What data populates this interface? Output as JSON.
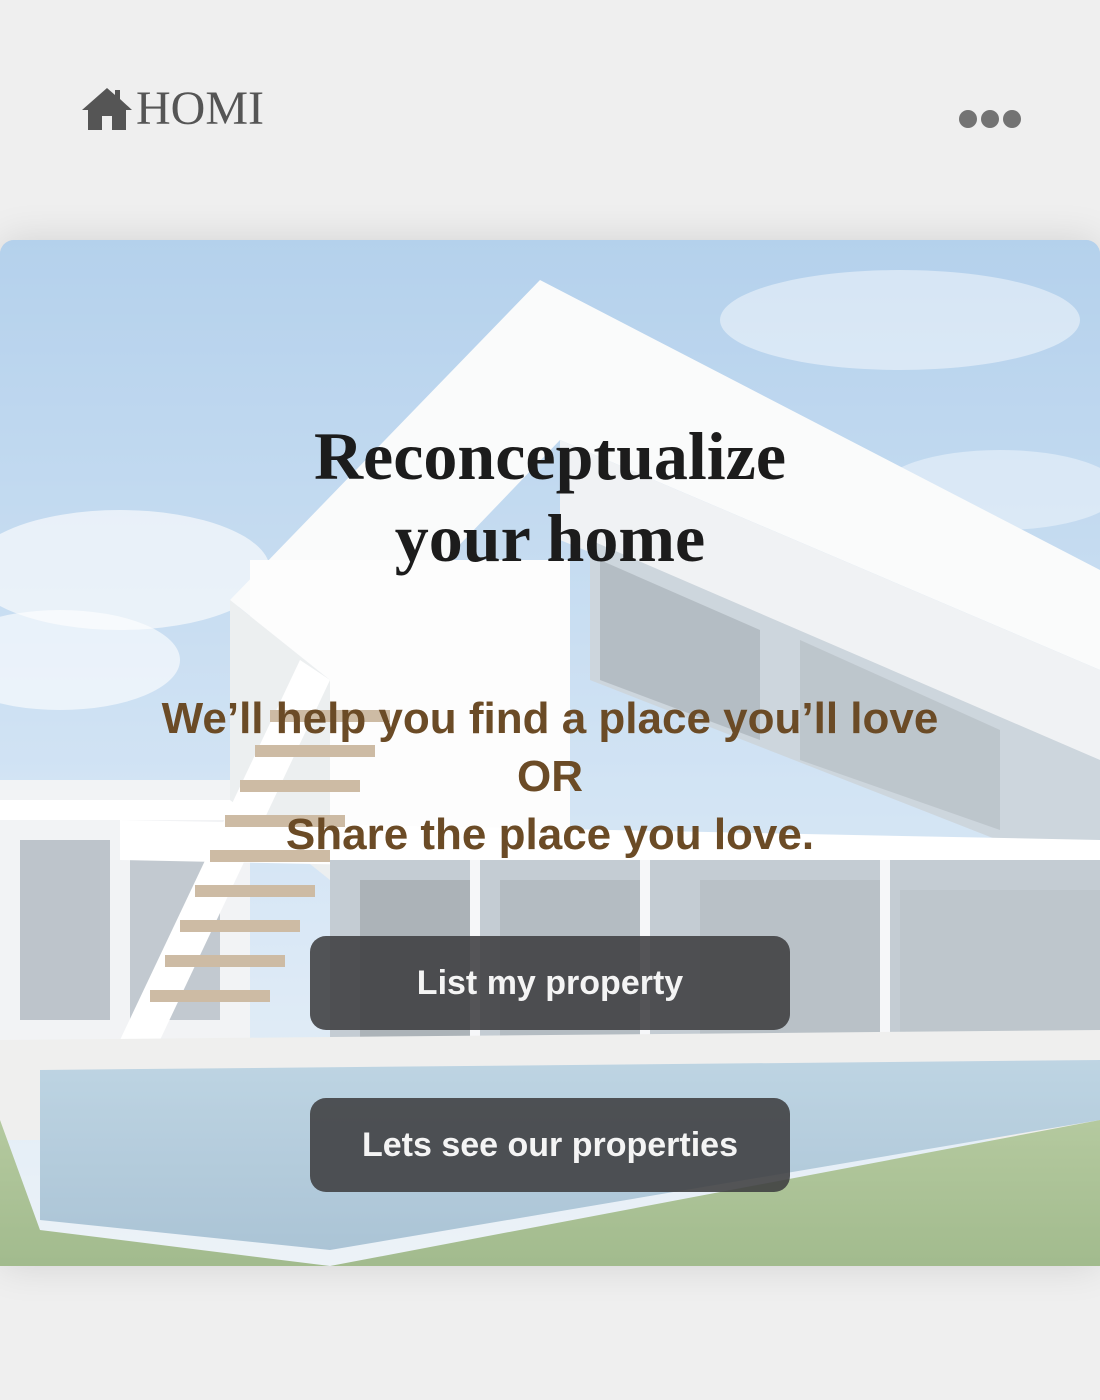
{
  "header": {
    "logo_text": "HOMI",
    "logo_icon": "house-icon",
    "menu_icon": "more-dots-icon"
  },
  "hero": {
    "background": "modern-white-villa-with-pool-photo",
    "title_line1": "Reconceptualize",
    "title_line2": "your home",
    "subtitle_line1": "We’ll help you find a place you’ll love",
    "subtitle_line2": "OR",
    "subtitle_line3": "Share the place you love.",
    "primary_button": "List my property",
    "secondary_button": "Lets see our properties"
  },
  "colors": {
    "page_background": "#efefef",
    "title": "#1c1c1c",
    "subtitle": "#6b4b26",
    "button_background": "#3e3e40",
    "button_text": "#f4f4f4",
    "logo": "#555555"
  }
}
